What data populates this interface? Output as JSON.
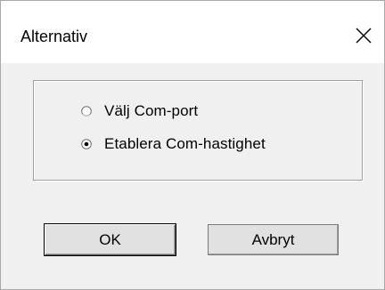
{
  "window": {
    "title": "Alternativ"
  },
  "options": {
    "items": [
      {
        "label": "Välj Com-port",
        "selected": false
      },
      {
        "label": "Etablera Com-hastighet",
        "selected": true
      }
    ]
  },
  "buttons": {
    "ok_label": "OK",
    "cancel_label": "Avbryt"
  },
  "icons": {
    "close": "close-icon",
    "radio_unselected": "radio-unselected-icon",
    "radio_selected": "radio-selected-icon"
  },
  "colors": {
    "dialog_background": "#f0f0f0",
    "titlebar_background": "#ffffff",
    "text": "#000000"
  }
}
